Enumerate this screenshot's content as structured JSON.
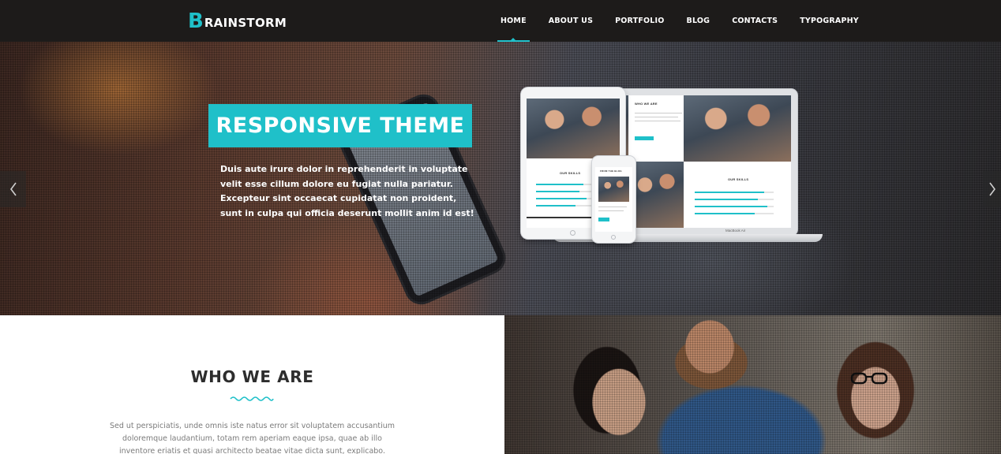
{
  "brand": {
    "letter": "B",
    "name": "RAINSTORM",
    "accent_color": "#1fc0c9"
  },
  "nav": {
    "items": [
      {
        "label": "HOME",
        "active": true
      },
      {
        "label": "ABOUT US",
        "active": false
      },
      {
        "label": "PORTFOLIO",
        "active": false
      },
      {
        "label": "BLOG",
        "active": false
      },
      {
        "label": "CONTACTS",
        "active": false
      },
      {
        "label": "TYPOGRAPHY",
        "active": false
      }
    ]
  },
  "hero": {
    "title": "RESPONSIVE THEME",
    "text_lines": [
      "Duis aute irure dolor in reprehenderit in voluptate",
      "velit esse cillum dolore eu fugiat nulla pariatur.",
      "Excepteur sint occaecat cupidatat non proident,",
      "sunt in culpa qui officia deserunt mollit anim id est!"
    ],
    "prev_icon": "chevron-left-icon",
    "next_icon": "chevron-right-icon"
  },
  "mockup": {
    "laptop_heading": "WHO WE ARE",
    "laptop_skills": "OUR SKILLS",
    "laptop_brand": "MacBook Air",
    "ipad_skills": "OUR SKILLS",
    "phone_heading": "FROM THE BLOG"
  },
  "who_we_are": {
    "title": "WHO WE ARE",
    "text_lines": [
      "Sed ut perspiciatis, unde omnis iste natus error sit voluptatem accusantium",
      "doloremque laudantium, totam rem aperiam eaque ipsa, quae ab illo",
      "inventore eriatis et quasi architecto beatae vitae dicta sunt, explicabo."
    ]
  }
}
